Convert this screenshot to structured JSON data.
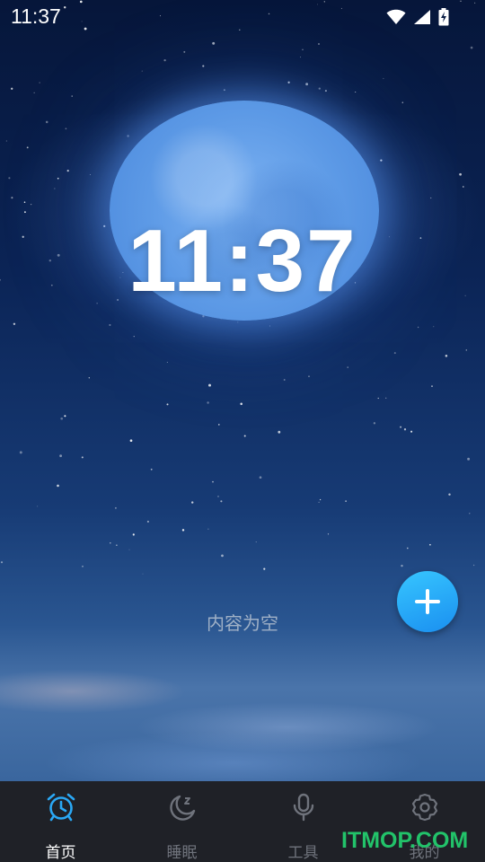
{
  "status_bar": {
    "time": "11:37",
    "icons": [
      "wifi-icon",
      "signal-icon",
      "battery-charging-icon"
    ]
  },
  "clock": {
    "time": "11:37"
  },
  "empty_state": {
    "text": "内容为空"
  },
  "fab": {
    "icon": "plus-icon"
  },
  "nav": {
    "items": [
      {
        "label": "首页",
        "icon": "alarm-clock-icon",
        "active": true
      },
      {
        "label": "睡眠",
        "icon": "moon-sleep-icon",
        "active": false
      },
      {
        "label": "工具",
        "icon": "microphone-icon",
        "active": false
      },
      {
        "label": "我的",
        "icon": "gear-icon",
        "active": false
      }
    ]
  },
  "watermark": {
    "text": "ITMOP.COM"
  },
  "colors": {
    "accent": "#2aa8f5",
    "nav_background": "#1f2127",
    "watermark": "#22c36a"
  }
}
